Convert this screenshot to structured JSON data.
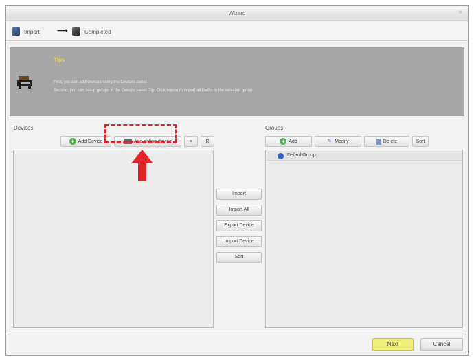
{
  "window": {
    "title": "Wizard",
    "close_glyph": "×"
  },
  "steps": {
    "items": [
      {
        "label": "Import",
        "icon": "import-step-icon"
      },
      {
        "label": "Completed",
        "icon": "completed-step-icon"
      }
    ],
    "arrow_glyph": "⟶"
  },
  "banner": {
    "heading": "Tips",
    "line1": "First, you can add devices using the Devices panel.",
    "line2": "Second, you can setup groups in the Groups panel. Tip: Click Import to import all DVRs to the selected group."
  },
  "devices": {
    "label": "Devices",
    "add_device": "Add Device",
    "add_online_device": "Add online device",
    "filter_glyph": "≡",
    "extra_glyph": "R"
  },
  "groups": {
    "label": "Groups",
    "add": "Add",
    "modify": "Modify",
    "delete": "Delete",
    "sort": "Sort",
    "items": [
      {
        "name": "DefaultGroup"
      }
    ]
  },
  "transfer": {
    "buttons": [
      "Import",
      "Import All",
      "Export Device",
      "Import Device",
      "Sort"
    ]
  },
  "footer": {
    "next": "Next",
    "cancel": "Cancel"
  },
  "colors": {
    "banner_bg": "#a7a7a7",
    "tip_heading": "#e6d24a",
    "next_button": "#f0ee7a",
    "annotation_red": "#e0242b",
    "group_icon": "#3366c8"
  }
}
